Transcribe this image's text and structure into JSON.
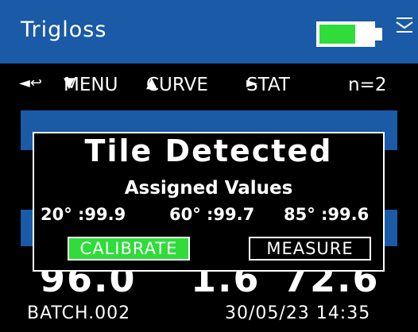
{
  "header": {
    "title": "Trigloss",
    "battery_level": 0.68,
    "battery_color": "#2fdc3a",
    "icons": [
      "battery-icon",
      "mail-icon"
    ]
  },
  "menu": {
    "back_glyph": "◄↩",
    "menu_glyph": "▼",
    "menu_label": "MENU",
    "curve_glyph": "▲",
    "curve_label": "CURVE",
    "stat_glyph": "►",
    "stat_label": "STAT",
    "count": "n=2"
  },
  "readings": {
    "values": [
      "96.0",
      "1.6",
      "72.6"
    ]
  },
  "footer": {
    "batch": "BATCH.002",
    "datetime": "30/05/23  14:35"
  },
  "dialog": {
    "title": "Tile Detected",
    "subtitle": "Assigned Values",
    "values": [
      {
        "label": "20° :99.9"
      },
      {
        "label": "60° :99.7"
      },
      {
        "label": "85° :99.6"
      }
    ],
    "calibrate_label": "CALIBRATE",
    "measure_label": "MEASURE"
  },
  "colors": {
    "header_blue": "#1a5aa6",
    "accent_green": "#2fdc3a"
  }
}
